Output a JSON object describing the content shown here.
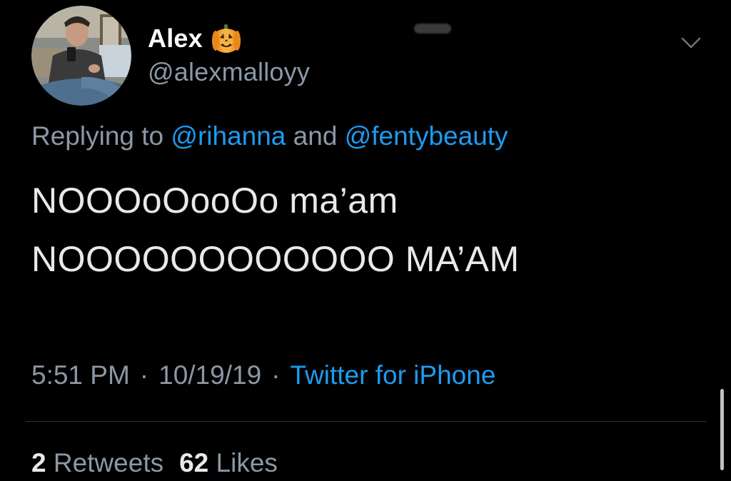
{
  "tweet": {
    "author": {
      "display_name": "Alex",
      "name_emoji": "pumpkin-emoji",
      "handle": "@alexmalloyy"
    },
    "reply": {
      "prefix": "Replying to",
      "mention1": "@rihanna",
      "conjunction": "and",
      "mention2": "@fentybeauty"
    },
    "text_lines": [
      "NOOOoOooOo ma’am",
      "NOOOOOOOOOOOO MA’AM"
    ],
    "meta": {
      "time": "5:51 PM",
      "date": "10/19/19",
      "separator": "·",
      "source": "Twitter for iPhone"
    },
    "stats": {
      "retweets_count": "2",
      "retweets_label": "Retweets",
      "likes_count": "62",
      "likes_label": "Likes"
    }
  },
  "icons": {
    "more": "chevron-down-icon"
  },
  "colors": {
    "background": "#000000",
    "primary_text": "#e7e9ea",
    "secondary_text": "#8b98a5",
    "link": "#1d9bf0",
    "divider": "#2f3336"
  }
}
